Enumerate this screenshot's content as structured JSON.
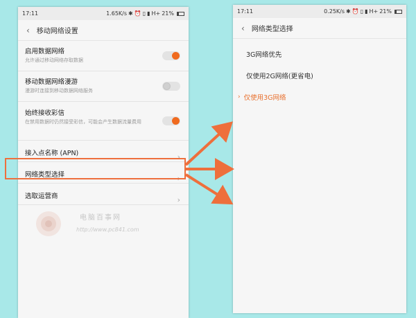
{
  "left_phone": {
    "status": {
      "time": "17:11",
      "speed": "1.65K/s",
      "network": "H+",
      "battery": "21%"
    },
    "title": "移动网络设置",
    "settings": [
      {
        "title": "启用数据网络",
        "subtitle": "允许通过移动网络存取数据",
        "control": "toggle",
        "state": "on"
      },
      {
        "title": "移动数据网络漫游",
        "subtitle": "漫游时连接到移动数据网络服务",
        "control": "toggle",
        "state": "off"
      },
      {
        "title": "始终接收彩信",
        "subtitle": "在禁用数据时仍然接受彩信，可能会产生数据流量费用",
        "control": "toggle",
        "state": "on"
      },
      {
        "title": "接入点名称 (APN)",
        "control": "chevron"
      },
      {
        "title": "网络类型选择",
        "control": "chevron",
        "highlighted": true
      },
      {
        "title": "选取运营商",
        "control": "chevron"
      }
    ],
    "watermark": {
      "text": "电脑百事网",
      "url": "http://www.pc841.com"
    }
  },
  "right_phone": {
    "status": {
      "time": "17:11",
      "speed": "0.25K/s",
      "network": "H+",
      "battery": "21%"
    },
    "title": "网络类型选择",
    "options": [
      {
        "label": "3G网络优先",
        "selected": false
      },
      {
        "label": "仅使用2G网络(更省电)",
        "selected": false
      },
      {
        "label": "仅使用3G网络",
        "selected": true
      }
    ]
  },
  "colors": {
    "accent": "#ee6f3c",
    "background": "#a8e8e8"
  },
  "icons": [
    "back-icon",
    "bluetooth-icon",
    "alarm-icon",
    "vibrate-icon",
    "signal-icon",
    "battery-icon",
    "chevron-right-icon",
    "selected-marker-icon",
    "arrow-icon"
  ]
}
